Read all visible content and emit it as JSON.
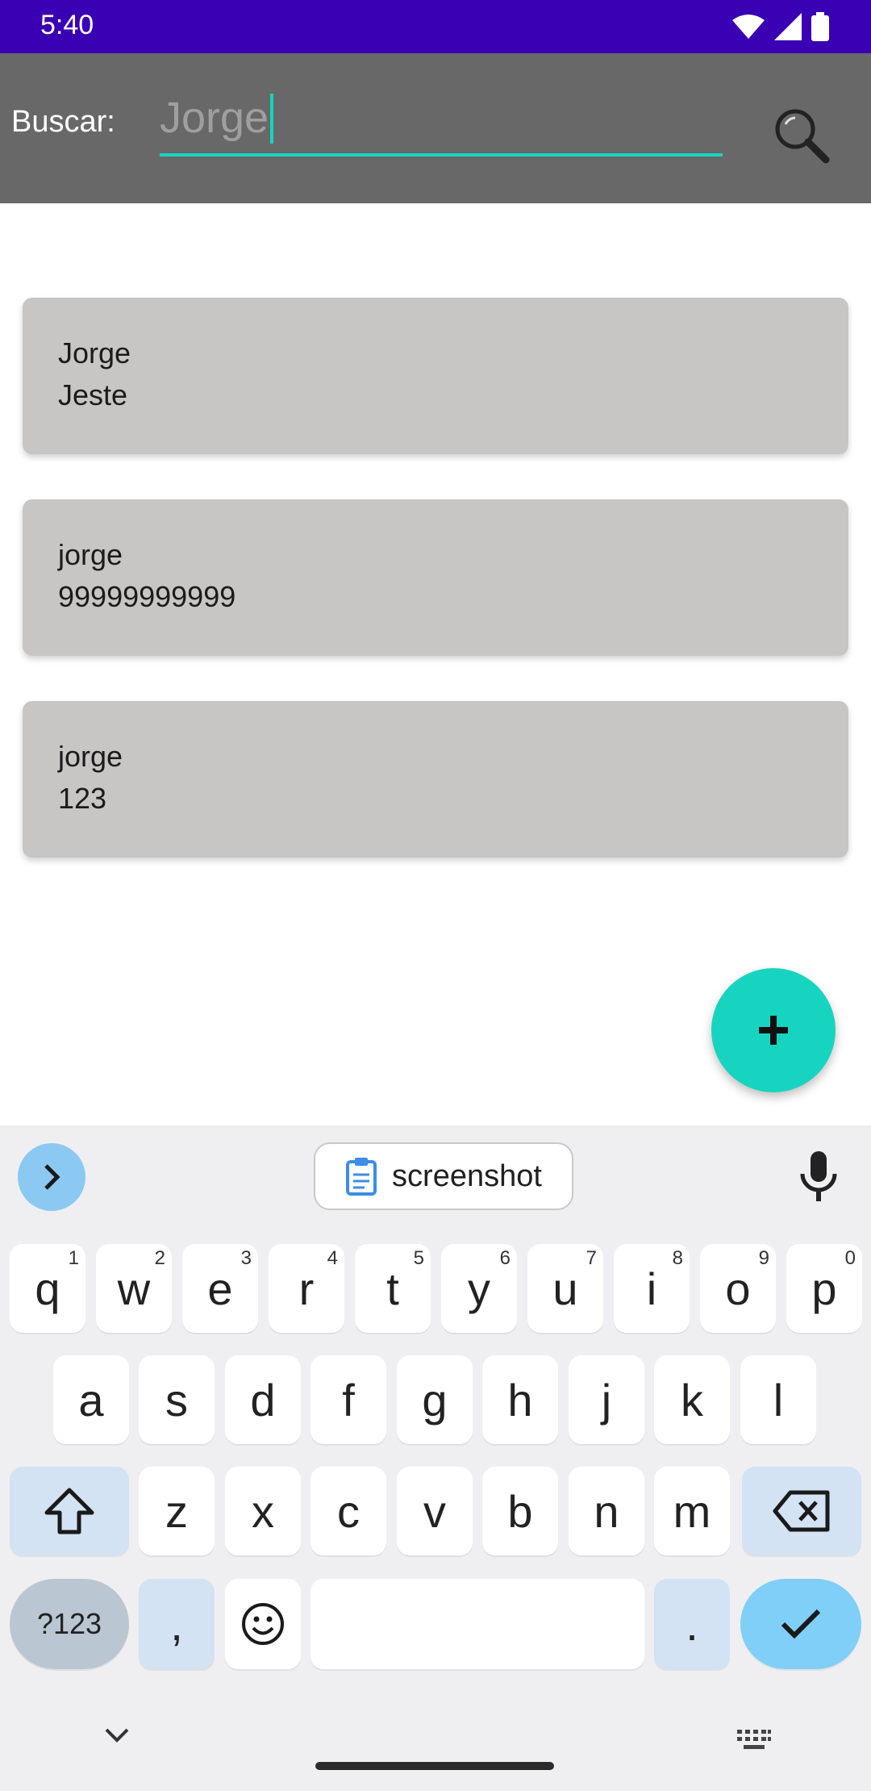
{
  "status_bar": {
    "time": "5:40"
  },
  "search": {
    "label": "Buscar:",
    "value": "Jorge"
  },
  "contacts": [
    {
      "name": "Jorge",
      "detail": "Jeste"
    },
    {
      "name": "jorge",
      "detail": "99999999999"
    },
    {
      "name": "jorge",
      "detail": "123"
    }
  ],
  "fab": {
    "icon": "plus-icon"
  },
  "keyboard": {
    "suggestion": "screenshot",
    "row1": [
      {
        "key": "q",
        "hint": "1"
      },
      {
        "key": "w",
        "hint": "2"
      },
      {
        "key": "e",
        "hint": "3"
      },
      {
        "key": "r",
        "hint": "4"
      },
      {
        "key": "t",
        "hint": "5"
      },
      {
        "key": "y",
        "hint": "6"
      },
      {
        "key": "u",
        "hint": "7"
      },
      {
        "key": "i",
        "hint": "8"
      },
      {
        "key": "o",
        "hint": "9"
      },
      {
        "key": "p",
        "hint": "0"
      }
    ],
    "row2": [
      "a",
      "s",
      "d",
      "f",
      "g",
      "h",
      "j",
      "k",
      "l"
    ],
    "row3": [
      "z",
      "x",
      "c",
      "v",
      "b",
      "n",
      "m"
    ],
    "symbols_label": "?123",
    "comma": ",",
    "period": "."
  },
  "colors": {
    "status_bar": "#3A00B4",
    "toolbar": "#686868",
    "accent": "#17D4C0",
    "card": "#C8C5C5"
  }
}
